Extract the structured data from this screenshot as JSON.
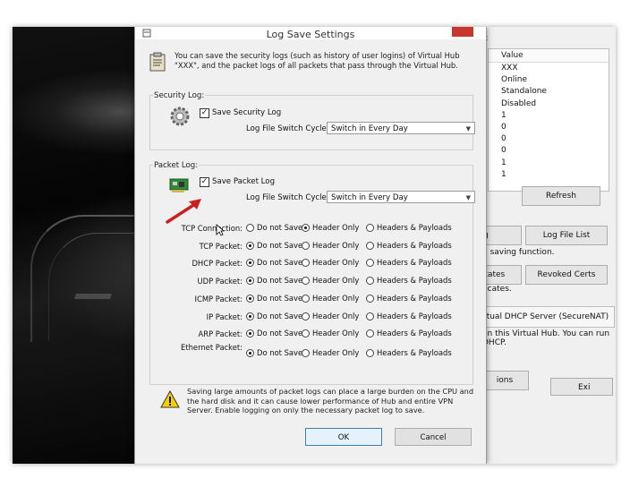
{
  "background_window": {
    "title_fragment": "):",
    "column_header": "Value",
    "values": [
      "XXX",
      "Online",
      "Standalone",
      "Disabled",
      "1",
      "0",
      "0",
      "0",
      "1",
      "1"
    ],
    "refresh_label": "Refresh",
    "g_fragment": "g",
    "log_file_list_label": "Log File List",
    "saving_fragment": "g saving function.",
    "cates_fragment": "cates",
    "revoked_certs_label": "Revoked Certs",
    "ficates_fragment": "ficates.",
    "securenat_fragment": "rtual DHCP Server (SecureNAT)",
    "run_fragment_1": "on this Virtual Hub. You can run",
    "run_fragment_2": "DHCP.",
    "ions_fragment": "ions",
    "exit_fragment": "Exi"
  },
  "dialog": {
    "title": "Log Save Settings",
    "intro": "You can save the security logs (such as history of user logins) of Virtual Hub \"XXX\", and the packet logs of all packets that pass through the Virtual Hub.",
    "security_log": {
      "group_label": "Security Log:",
      "checkbox_label": "Save Security Log",
      "checked": true,
      "cycle_label": "Log File Switch Cycle:",
      "cycle_value": "Switch in Every Day"
    },
    "packet_log": {
      "group_label": "Packet Log:",
      "checkbox_label": "Save Packet Log",
      "checked": true,
      "cycle_label": "Log File Switch Cycle:",
      "cycle_value": "Switch in Every Day",
      "options": [
        "Do not Save",
        "Header Only",
        "Headers & Payloads"
      ],
      "rows": [
        {
          "label": "TCP Connection:",
          "selected": 1
        },
        {
          "label": "TCP Packet:",
          "selected": 0
        },
        {
          "label": "DHCP Packet:",
          "selected": 0
        },
        {
          "label": "UDP Packet:",
          "selected": 0
        },
        {
          "label": "ICMP Packet:",
          "selected": 0
        },
        {
          "label": "IP Packet:",
          "selected": 0
        },
        {
          "label": "ARP Packet:",
          "selected": 0
        },
        {
          "label": "Ethernet Packet:",
          "selected": 0
        }
      ]
    },
    "warning": "Saving large amounts of packet logs can place a large burden on the CPU and the hard disk and it can cause lower performance of Hub and entire VPN Server. Enable logging on only the necessary packet log to save.",
    "ok_label": "OK",
    "cancel_label": "Cancel"
  },
  "colors": {
    "arrow": "#cc1f1f",
    "close_button": "#c9362b"
  }
}
